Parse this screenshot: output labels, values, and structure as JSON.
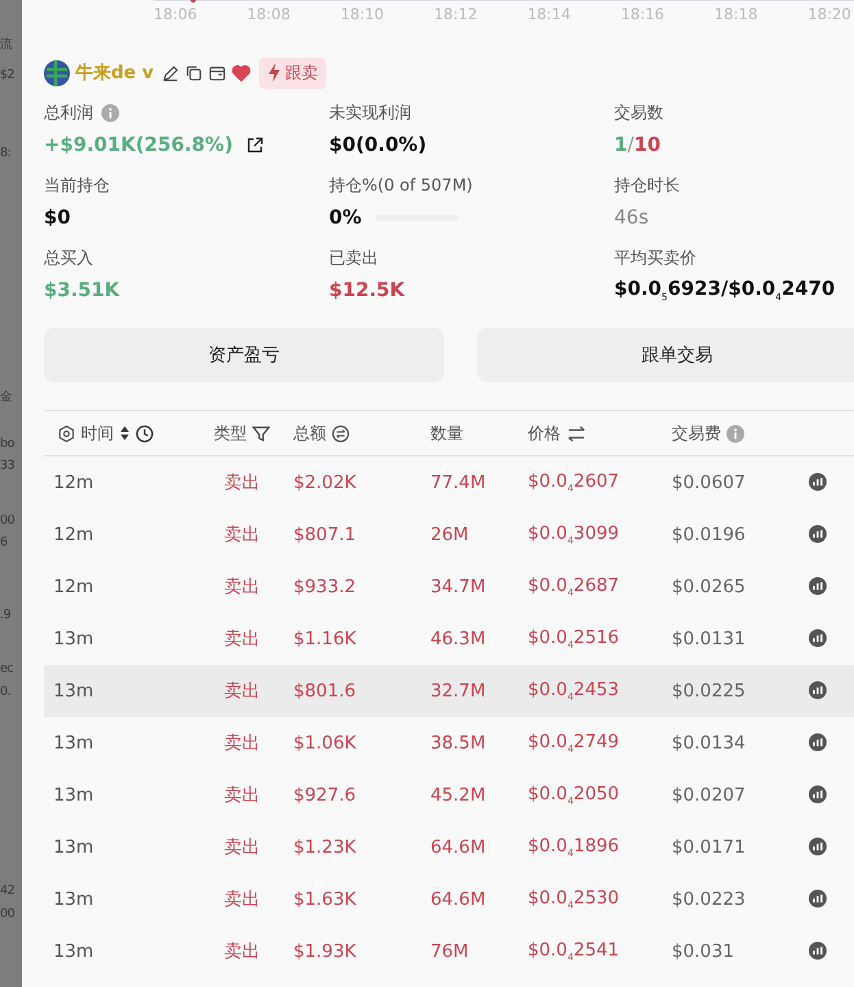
{
  "backdrop": {
    "fragments": [
      "流",
      "$2",
      "8:",
      "金",
      "bo",
      "33",
      "00",
      "6",
      ".9",
      "ec",
      "0.",
      "42",
      "00"
    ]
  },
  "chart": {
    "x_labels": [
      "18:06",
      "18:08",
      "18:10",
      "18:12",
      "18:14",
      "18:16",
      "18:18",
      "18:20"
    ]
  },
  "wallet": {
    "name": "牛来de v",
    "favorite": true,
    "badge": "跟卖"
  },
  "stats": [
    {
      "label": "总利润",
      "info": true,
      "value": "+$9.01K(256.8%)",
      "link": true
    },
    {
      "label": "未实现利润",
      "value": "$0(0.0%)"
    },
    {
      "label": "交易数",
      "value_parts": [
        "1",
        "/",
        "10"
      ]
    },
    {
      "label": "当前持仓",
      "value": "$0"
    },
    {
      "label": "持仓%(0 of 507M)",
      "value": "0%",
      "level": 0
    },
    {
      "label": "持仓时长",
      "value": "46s"
    },
    {
      "label": "总买入",
      "value": "$3.51K"
    },
    {
      "label": "已卖出",
      "value": "$12.5K"
    },
    {
      "label": "平均买卖价",
      "value": "$0.0$_{5}$6923/$0.0$_{4}$2470"
    }
  ],
  "buttons": [
    "资产盈亏",
    "跟单交易"
  ],
  "table": {
    "columns": [
      "时间",
      "类型",
      "总额",
      "数量",
      "价格",
      "交易费"
    ],
    "rows": [
      {
        "time": "12m",
        "type": "卖出",
        "amount": "$2.02K",
        "qty": "77.4M",
        "price": "$0.0$_{4}$2607",
        "fee": "$0.0607",
        "highlighted": false
      },
      {
        "time": "12m",
        "type": "卖出",
        "amount": "$807.1",
        "qty": "26M",
        "price": "$0.0$_{4}$3099",
        "fee": "$0.0196",
        "highlighted": false
      },
      {
        "time": "12m",
        "type": "卖出",
        "amount": "$933.2",
        "qty": "34.7M",
        "price": "$0.0$_{4}$2687",
        "fee": "$0.0265",
        "highlighted": false
      },
      {
        "time": "13m",
        "type": "卖出",
        "amount": "$1.16K",
        "qty": "46.3M",
        "price": "$0.0$_{4}$2516",
        "fee": "$0.0131",
        "highlighted": false
      },
      {
        "time": "13m",
        "type": "卖出",
        "amount": "$801.6",
        "qty": "32.7M",
        "price": "$0.0$_{4}$2453",
        "fee": "$0.0225",
        "highlighted": true
      },
      {
        "time": "13m",
        "type": "卖出",
        "amount": "$1.06K",
        "qty": "38.5M",
        "price": "$0.0$_{4}$2749",
        "fee": "$0.0134",
        "highlighted": false
      },
      {
        "time": "13m",
        "type": "卖出",
        "amount": "$927.6",
        "qty": "45.2M",
        "price": "$0.0$_{4}$2050",
        "fee": "$0.0207",
        "highlighted": false
      },
      {
        "time": "13m",
        "type": "卖出",
        "amount": "$1.23K",
        "qty": "64.6M",
        "price": "$0.0$_{4}$1896",
        "fee": "$0.0171",
        "highlighted": false
      },
      {
        "time": "13m",
        "type": "卖出",
        "amount": "$1.63K",
        "qty": "64.6M",
        "price": "$0.0$_{4}$2530",
        "fee": "$0.0223",
        "highlighted": false
      },
      {
        "time": "13m",
        "type": "卖出",
        "amount": "$1.93K",
        "qty": "76M",
        "price": "$0.0$_{4}$2541",
        "fee": "$0.031",
        "highlighted": false
      }
    ]
  }
}
